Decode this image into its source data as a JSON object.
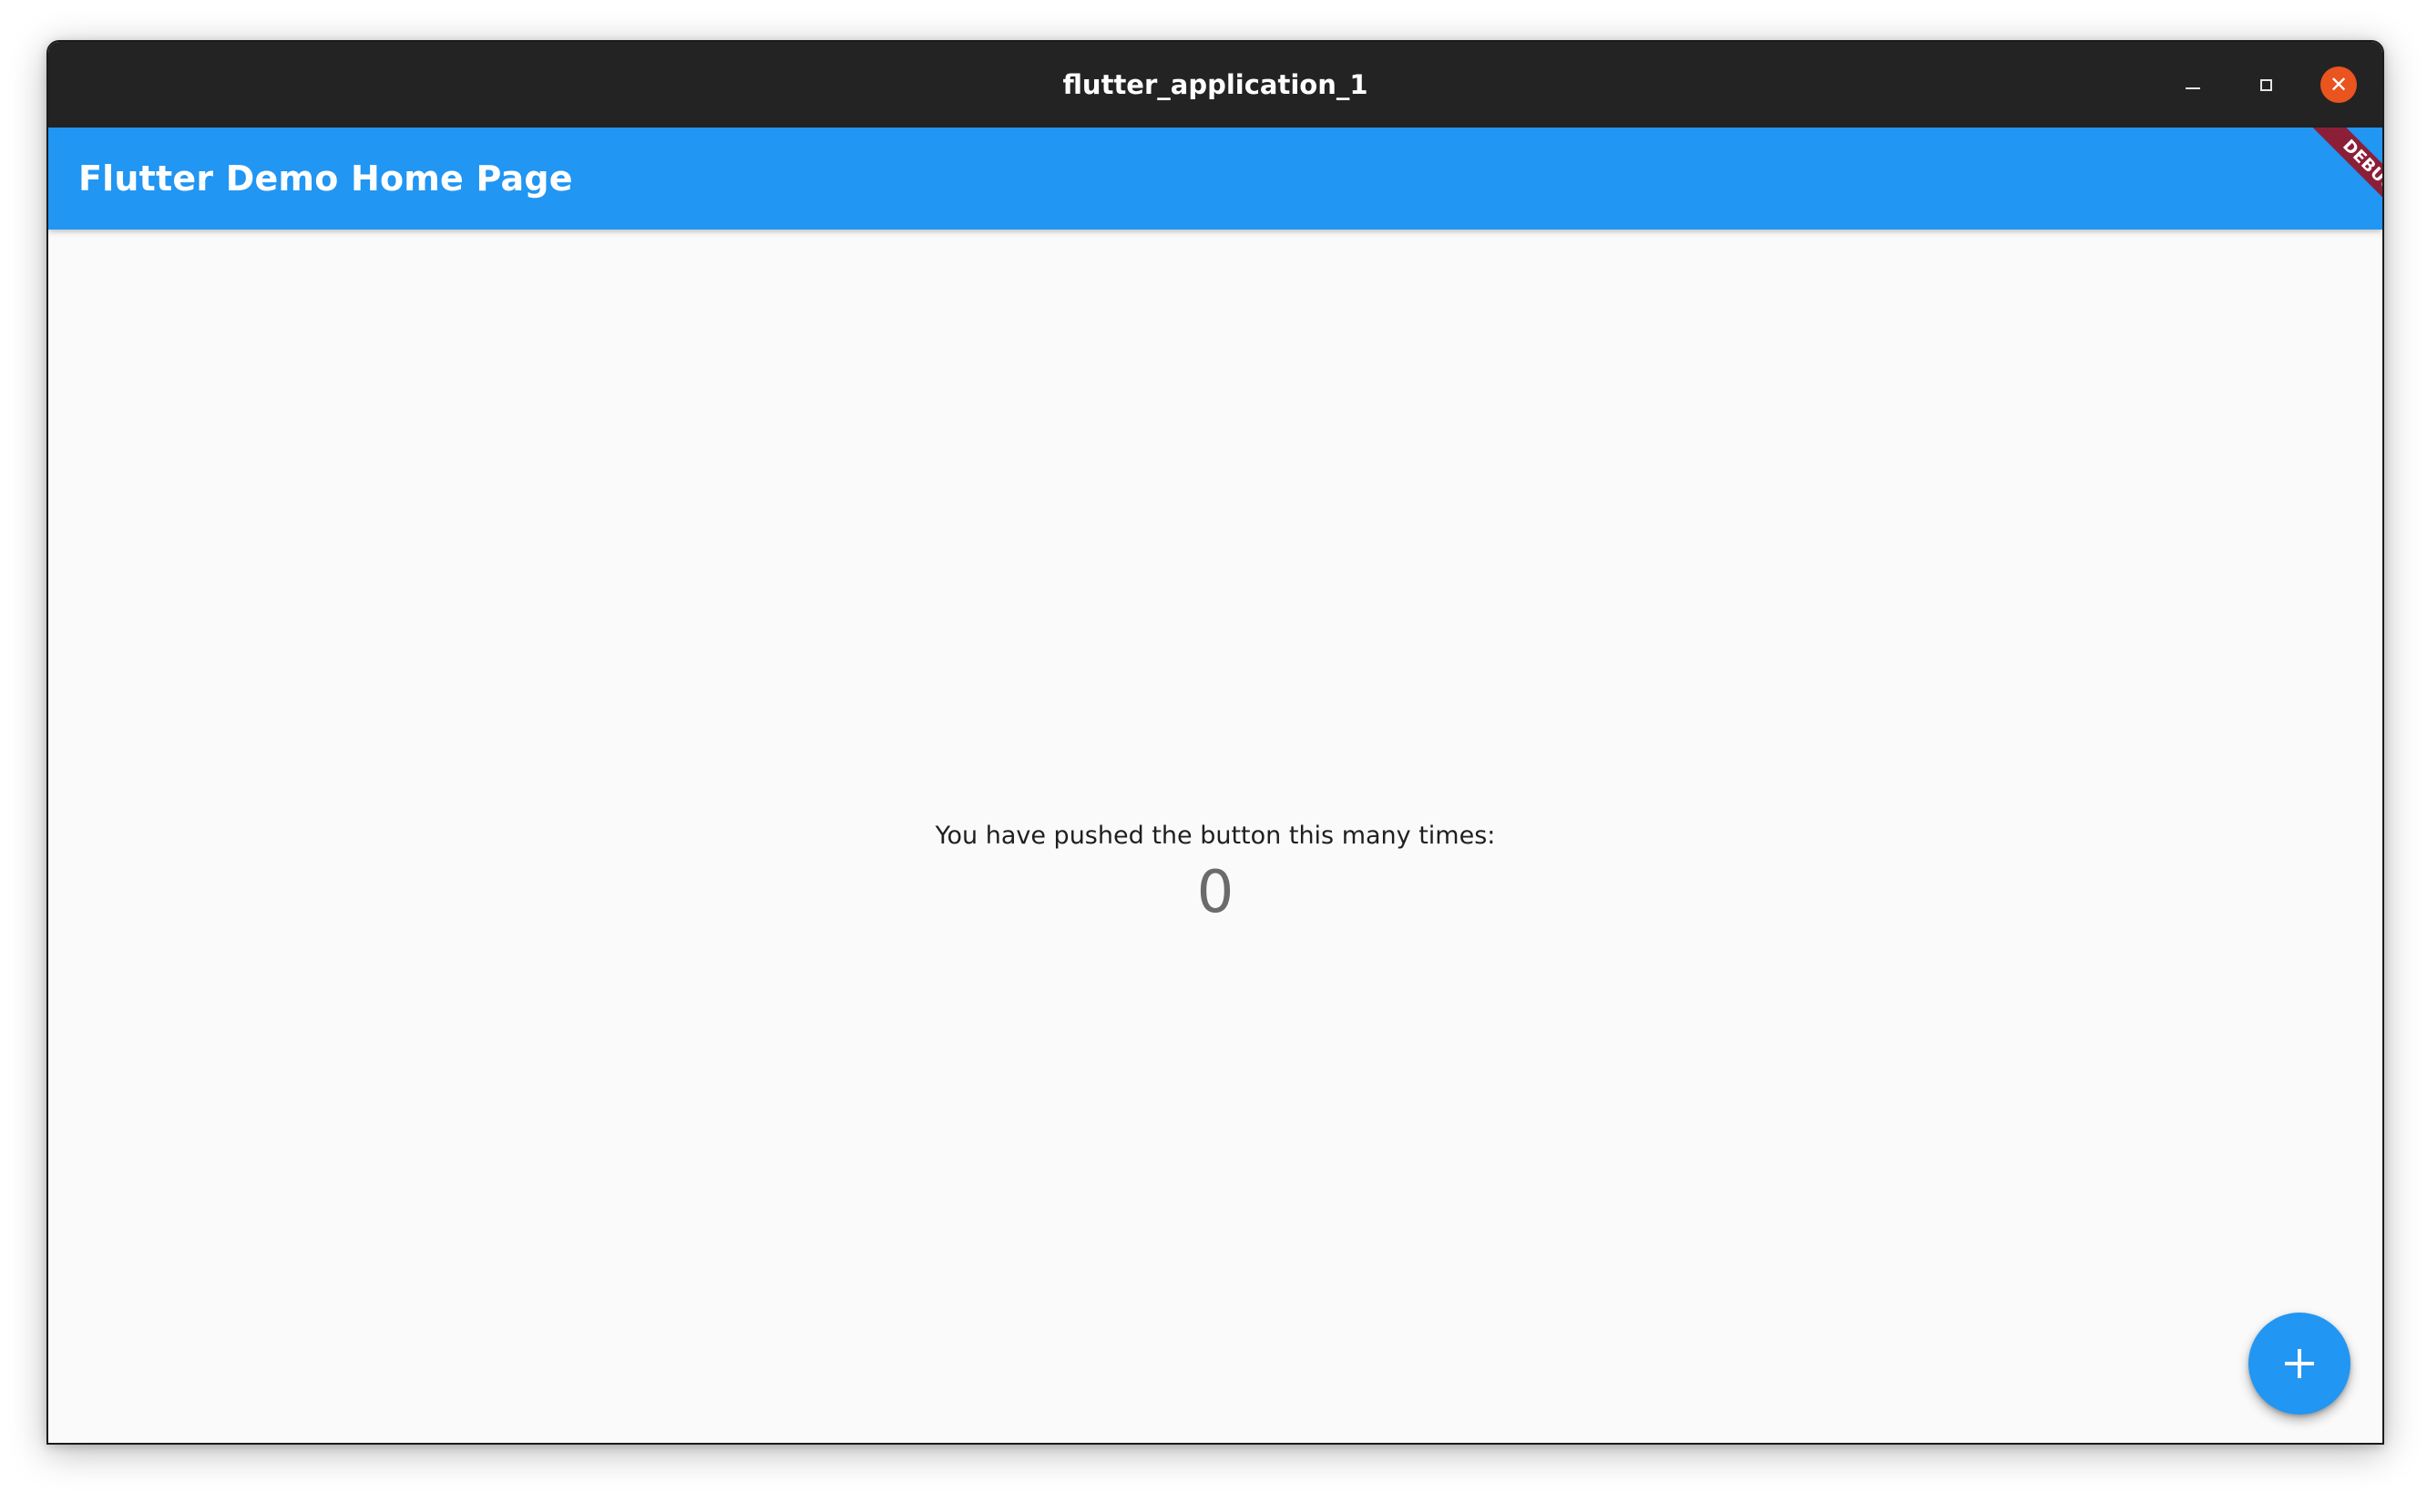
{
  "window": {
    "title": "flutter_application_1",
    "controls": {
      "minimize_icon": "minimize-icon",
      "maximize_icon": "maximize-icon",
      "close_icon": "close-icon",
      "close_glyph": "✕",
      "close_color": "#e9541f"
    }
  },
  "appbar": {
    "title": "Flutter Demo Home Page",
    "color": "#2196f3"
  },
  "debug_banner": {
    "label": "DEBUG",
    "color": "#8c1f38"
  },
  "body": {
    "counter_label": "You have pushed the button this many times:",
    "counter_value": "0"
  },
  "fab": {
    "icon": "add-icon",
    "color": "#2196f3"
  }
}
